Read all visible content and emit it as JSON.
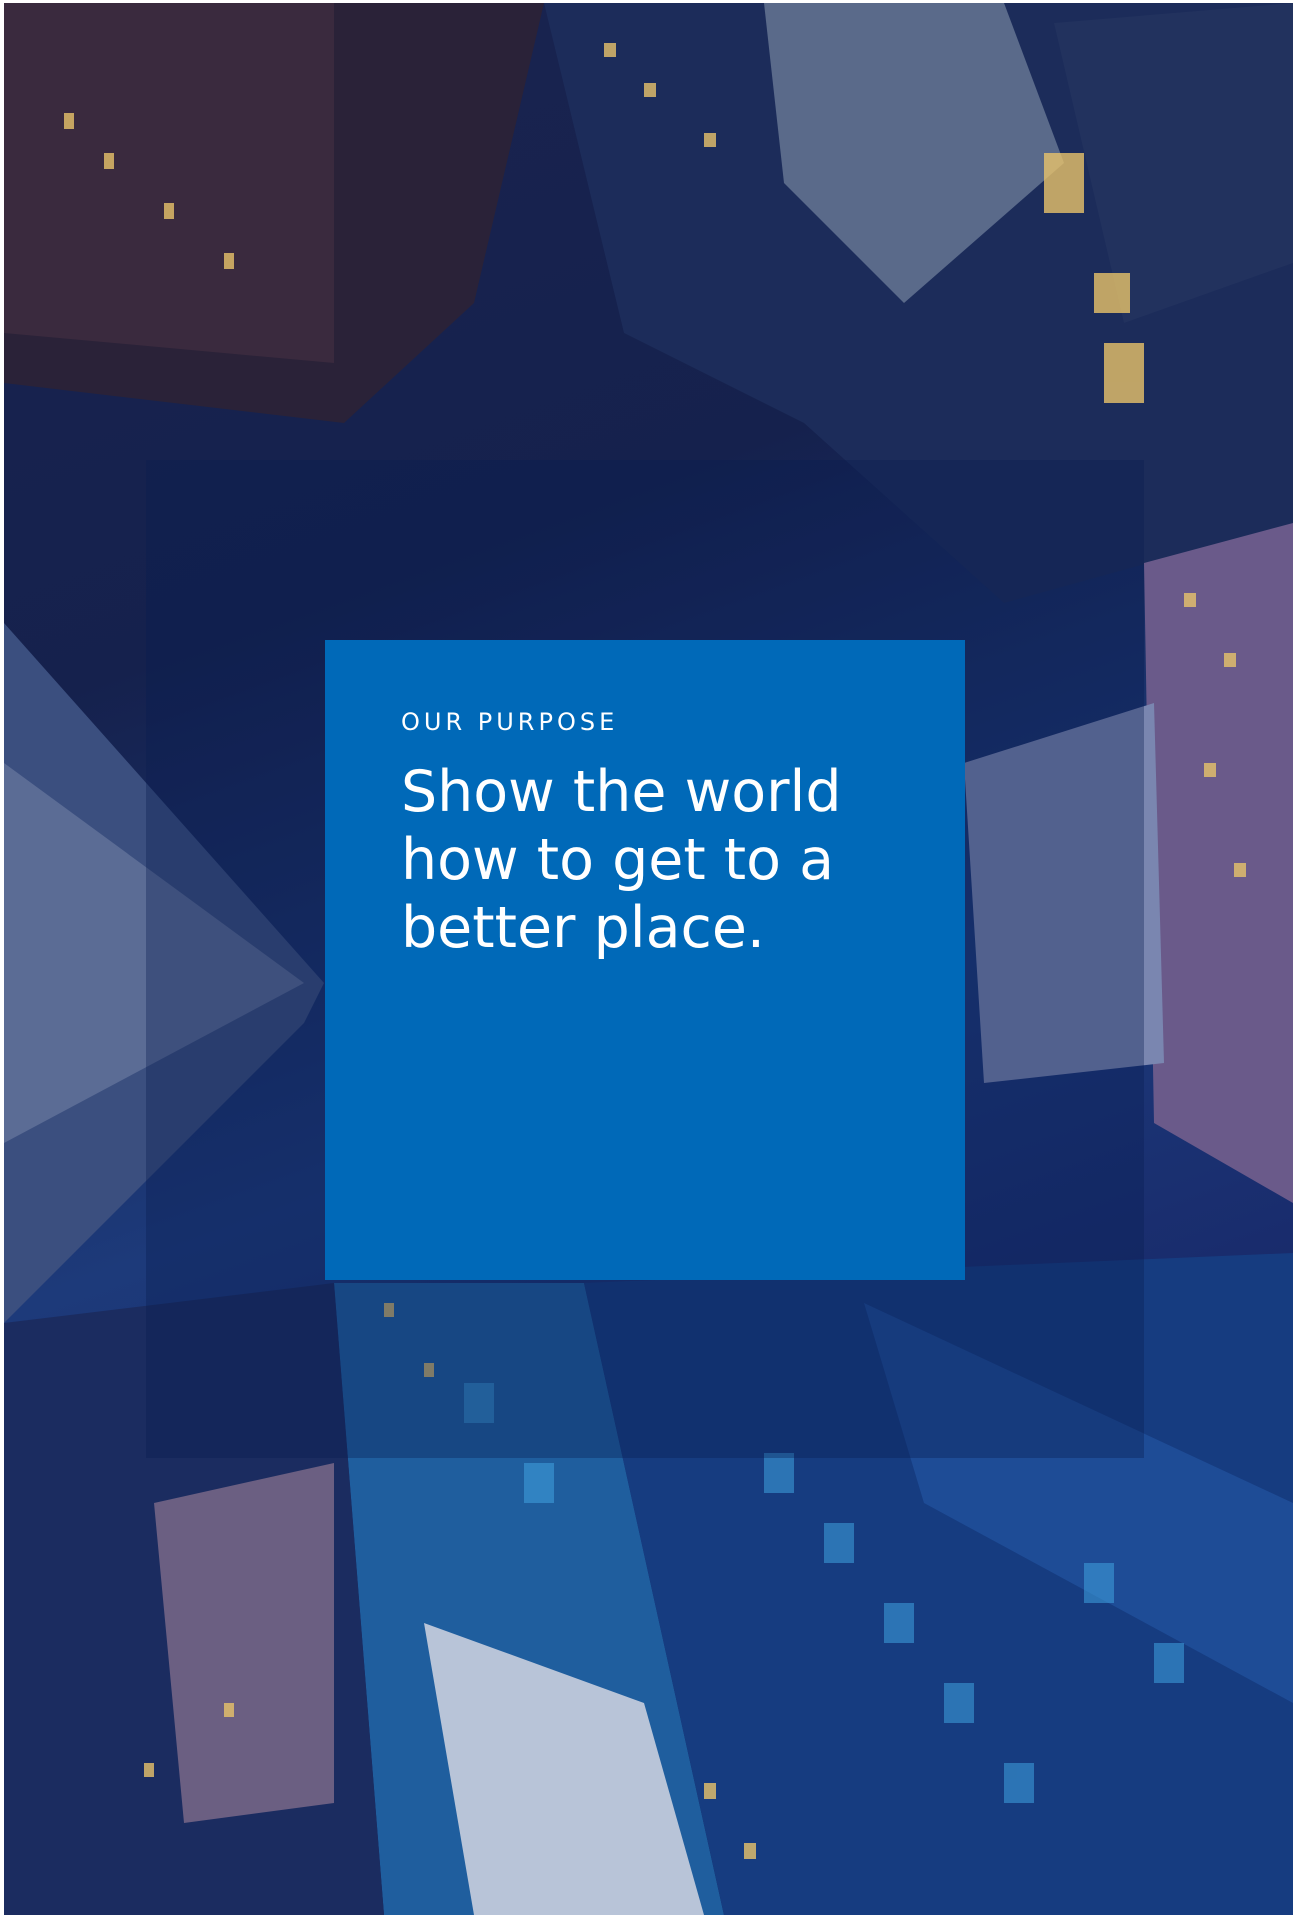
{
  "purpose": {
    "eyebrow": "OUR PURPOSE",
    "headline": "Show the world how to get to a better place."
  },
  "background_image": "aerial-night-city-skyscrapers",
  "colors": {
    "card": "#0069b8",
    "text": "#ffffff",
    "overlay": "#0a1e50"
  }
}
